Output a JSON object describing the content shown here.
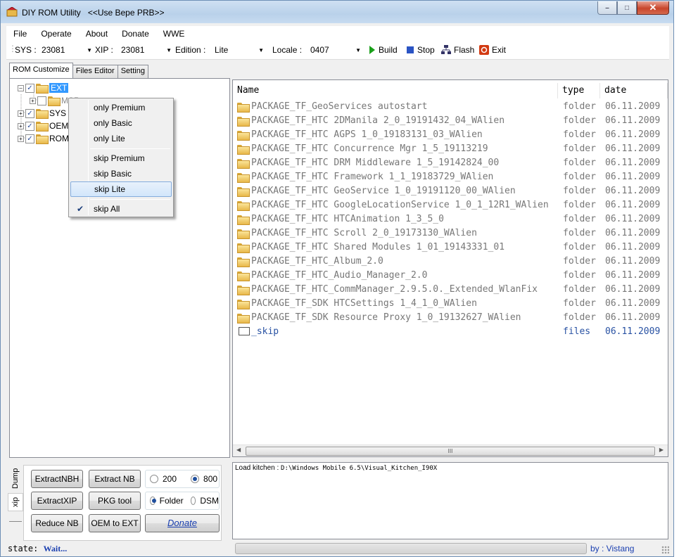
{
  "window": {
    "title": "DIY ROM Utility",
    "subtitle": "<<Use Bepe PRB>>"
  },
  "menu": [
    "File",
    "Operate",
    "About",
    "Donate",
    "WWE"
  ],
  "toolbar": {
    "sys_label": "SYS :",
    "sys_value": "23081",
    "xip_label": "XIP :",
    "xip_value": "23081",
    "edition_label": "Edition :",
    "edition_value": "Lite",
    "locale_label": "Locale :",
    "locale_value": "0407",
    "build": "Build",
    "stop": "Stop",
    "flash": "Flash",
    "exit": "Exit",
    "colors": {
      "build": "#1aa01a",
      "stop": "#2b54c4",
      "exit": "#d23a12"
    }
  },
  "tabs": [
    "ROM Customize",
    "Files Editor",
    "Setting"
  ],
  "tree": {
    "nodes": [
      {
        "label": "EXT",
        "checked": true,
        "selected": true
      },
      {
        "label": "MSP",
        "checked": false
      },
      {
        "label": "SYS",
        "checked": true
      },
      {
        "label": "OEM",
        "checked": true
      },
      {
        "label": "ROM",
        "checked": true
      }
    ]
  },
  "context_menu": {
    "items": [
      "only Premium",
      "only Basic",
      "only Lite",
      "skip Premium",
      "skip Basic",
      "skip Lite",
      "skip All"
    ],
    "highlighted": "skip Lite",
    "checked": "skip All"
  },
  "list": {
    "headers": {
      "name": "Name",
      "type": "type",
      "date": "date"
    },
    "rows": [
      {
        "name": "PACKAGE_TF_GeoServices autostart",
        "type": "folder",
        "date": "06.11.2009"
      },
      {
        "name": "PACKAGE_TF_HTC 2DManila 2_0_19191432_04_WAlien",
        "type": "folder",
        "date": "06.11.2009"
      },
      {
        "name": "PACKAGE_TF_HTC AGPS 1_0_19183131_03_WAlien",
        "type": "folder",
        "date": "06.11.2009"
      },
      {
        "name": "PACKAGE_TF_HTC Concurrence Mgr 1_5_19113219",
        "type": "folder",
        "date": "06.11.2009"
      },
      {
        "name": "PACKAGE_TF_HTC DRM Middleware 1_5_19142824_00",
        "type": "folder",
        "date": "06.11.2009"
      },
      {
        "name": "PACKAGE_TF_HTC Framework 1_1_19183729_WAlien",
        "type": "folder",
        "date": "06.11.2009"
      },
      {
        "name": "PACKAGE_TF_HTC GeoService 1_0_19191120_00_WAlien",
        "type": "folder",
        "date": "06.11.2009"
      },
      {
        "name": "PACKAGE_TF_HTC GoogleLocationService 1_0_1_12R1_WAlien",
        "type": "folder",
        "date": "06.11.2009"
      },
      {
        "name": "PACKAGE_TF_HTC HTCAnimation 1_3_5_0",
        "type": "folder",
        "date": "06.11.2009"
      },
      {
        "name": "PACKAGE_TF_HTC Scroll 2_0_19173130_WAlien",
        "type": "folder",
        "date": "06.11.2009"
      },
      {
        "name": "PACKAGE_TF_HTC Shared Modules 1_01_19143331_01",
        "type": "folder",
        "date": "06.11.2009"
      },
      {
        "name": "PACKAGE_TF_HTC_Album_2.0",
        "type": "folder",
        "date": "06.11.2009"
      },
      {
        "name": "PACKAGE_TF_HTC_Audio_Manager_2.0",
        "type": "folder",
        "date": "06.11.2009"
      },
      {
        "name": "PACKAGE_TF_HTC_CommManager_2.9.5.0._Extended_WlanFix",
        "type": "folder",
        "date": "06.11.2009"
      },
      {
        "name": "PACKAGE_TF_SDK HTCSettings 1_4_1_0_WAlien",
        "type": "folder",
        "date": "06.11.2009"
      },
      {
        "name": "PACKAGE_TF_SDK Resource Proxy 1_0_19132627_WAlien",
        "type": "folder",
        "date": "06.11.2009"
      },
      {
        "name": "_skip",
        "type": "files",
        "date": "06.11.2009"
      }
    ],
    "scroll_glyph": "III"
  },
  "side_tabs": [
    "Dump",
    "xip"
  ],
  "buttons": {
    "extract_nbh": "ExtractNBH",
    "extract_nb": "Extract NB",
    "extract_xip": "ExtractXIP",
    "pkg_tool": "PKG tool",
    "reduce_nb": "Reduce NB",
    "oem_to_ext": "OEM to EXT",
    "donate": "Donate"
  },
  "options": {
    "r200": "200",
    "r800": "800",
    "size_selected": "800",
    "folder": "Folder",
    "dsm": "DSM",
    "mode_selected": "Folder"
  },
  "log": {
    "label": "Load kitchen :",
    "path": "D:\\Windows Mobile 6.5\\Visual_Kitchen_I90X"
  },
  "status": {
    "label": "state:",
    "value": "Wait...",
    "progress": 0,
    "by": "by : Vistang"
  }
}
